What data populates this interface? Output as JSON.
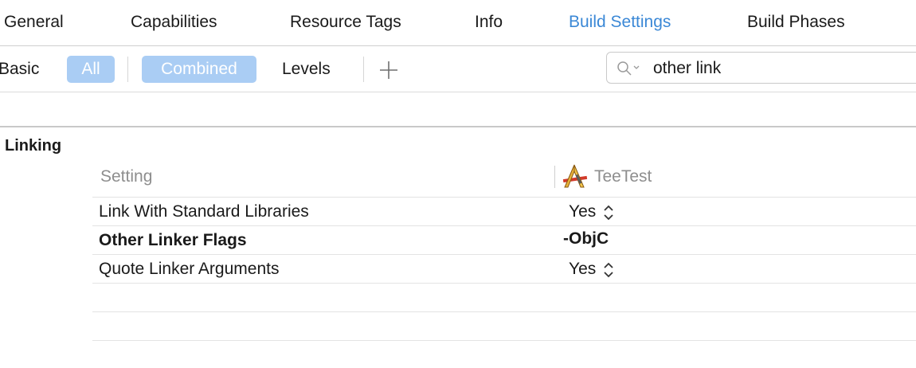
{
  "tabs": [
    {
      "label": "General",
      "active": false
    },
    {
      "label": "Capabilities",
      "active": false
    },
    {
      "label": "Resource Tags",
      "active": false
    },
    {
      "label": "Info",
      "active": false
    },
    {
      "label": "Build Settings",
      "active": true
    },
    {
      "label": "Build Phases",
      "active": false
    }
  ],
  "toolbar": {
    "basic_label": "Basic",
    "all_label": "All",
    "combined_label": "Combined",
    "levels_label": "Levels",
    "add_label": "+"
  },
  "search": {
    "value": "other link",
    "icon": "search-icon"
  },
  "section": {
    "title": "Linking"
  },
  "table": {
    "setting_header": "Setting",
    "target_header": "TeeTest",
    "target_icon": "app-target-icon",
    "rows": [
      {
        "setting": "Link With Standard Libraries",
        "value": "Yes",
        "bold": false,
        "stepper": true
      },
      {
        "setting": "Other Linker Flags",
        "value": "-ObjC",
        "bold": true,
        "stepper": false
      },
      {
        "setting": "Quote Linker Arguments",
        "value": "Yes",
        "bold": false,
        "stepper": true
      }
    ]
  },
  "colors": {
    "accent": "#3b88d6",
    "pill": "#aacdf4",
    "muted": "#8e8e8e"
  }
}
